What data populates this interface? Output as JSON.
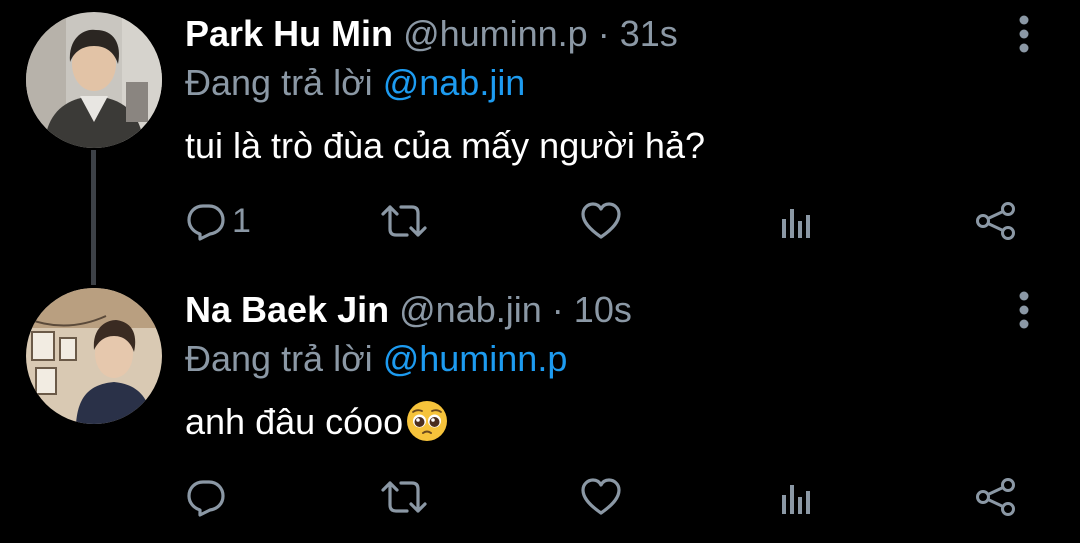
{
  "tweets": [
    {
      "display_name": "Park Hu Min",
      "handle": "@huminn.p",
      "separator": "·",
      "time": "31s",
      "reply_prefix": "Đang trả lời",
      "reply_to": "@nab.jin",
      "text": "tui là trò đùa của mấy người hả?",
      "reply_count": "1",
      "avatar": "avatar-park-hu-min"
    },
    {
      "display_name": "Na Baek Jin",
      "handle": "@nab.jin",
      "separator": "·",
      "time": "10s",
      "reply_prefix": "Đang trả lời",
      "reply_to": "@huminn.p",
      "text": "anh đâu cóoo",
      "emoji": "pleading-face",
      "reply_count": "",
      "avatar": "avatar-na-baek-jin"
    }
  ],
  "icons": {
    "reply": "reply-icon",
    "retweet": "retweet-icon",
    "like": "heart-icon",
    "stats": "stats-icon",
    "share": "share-icon",
    "more": "more-vertical-icon"
  },
  "colors": {
    "background": "#000000",
    "text_primary": "#ffffff",
    "text_secondary": "#8b98a5",
    "mention": "#1d9bf0",
    "thread_line": "#3d4147"
  }
}
